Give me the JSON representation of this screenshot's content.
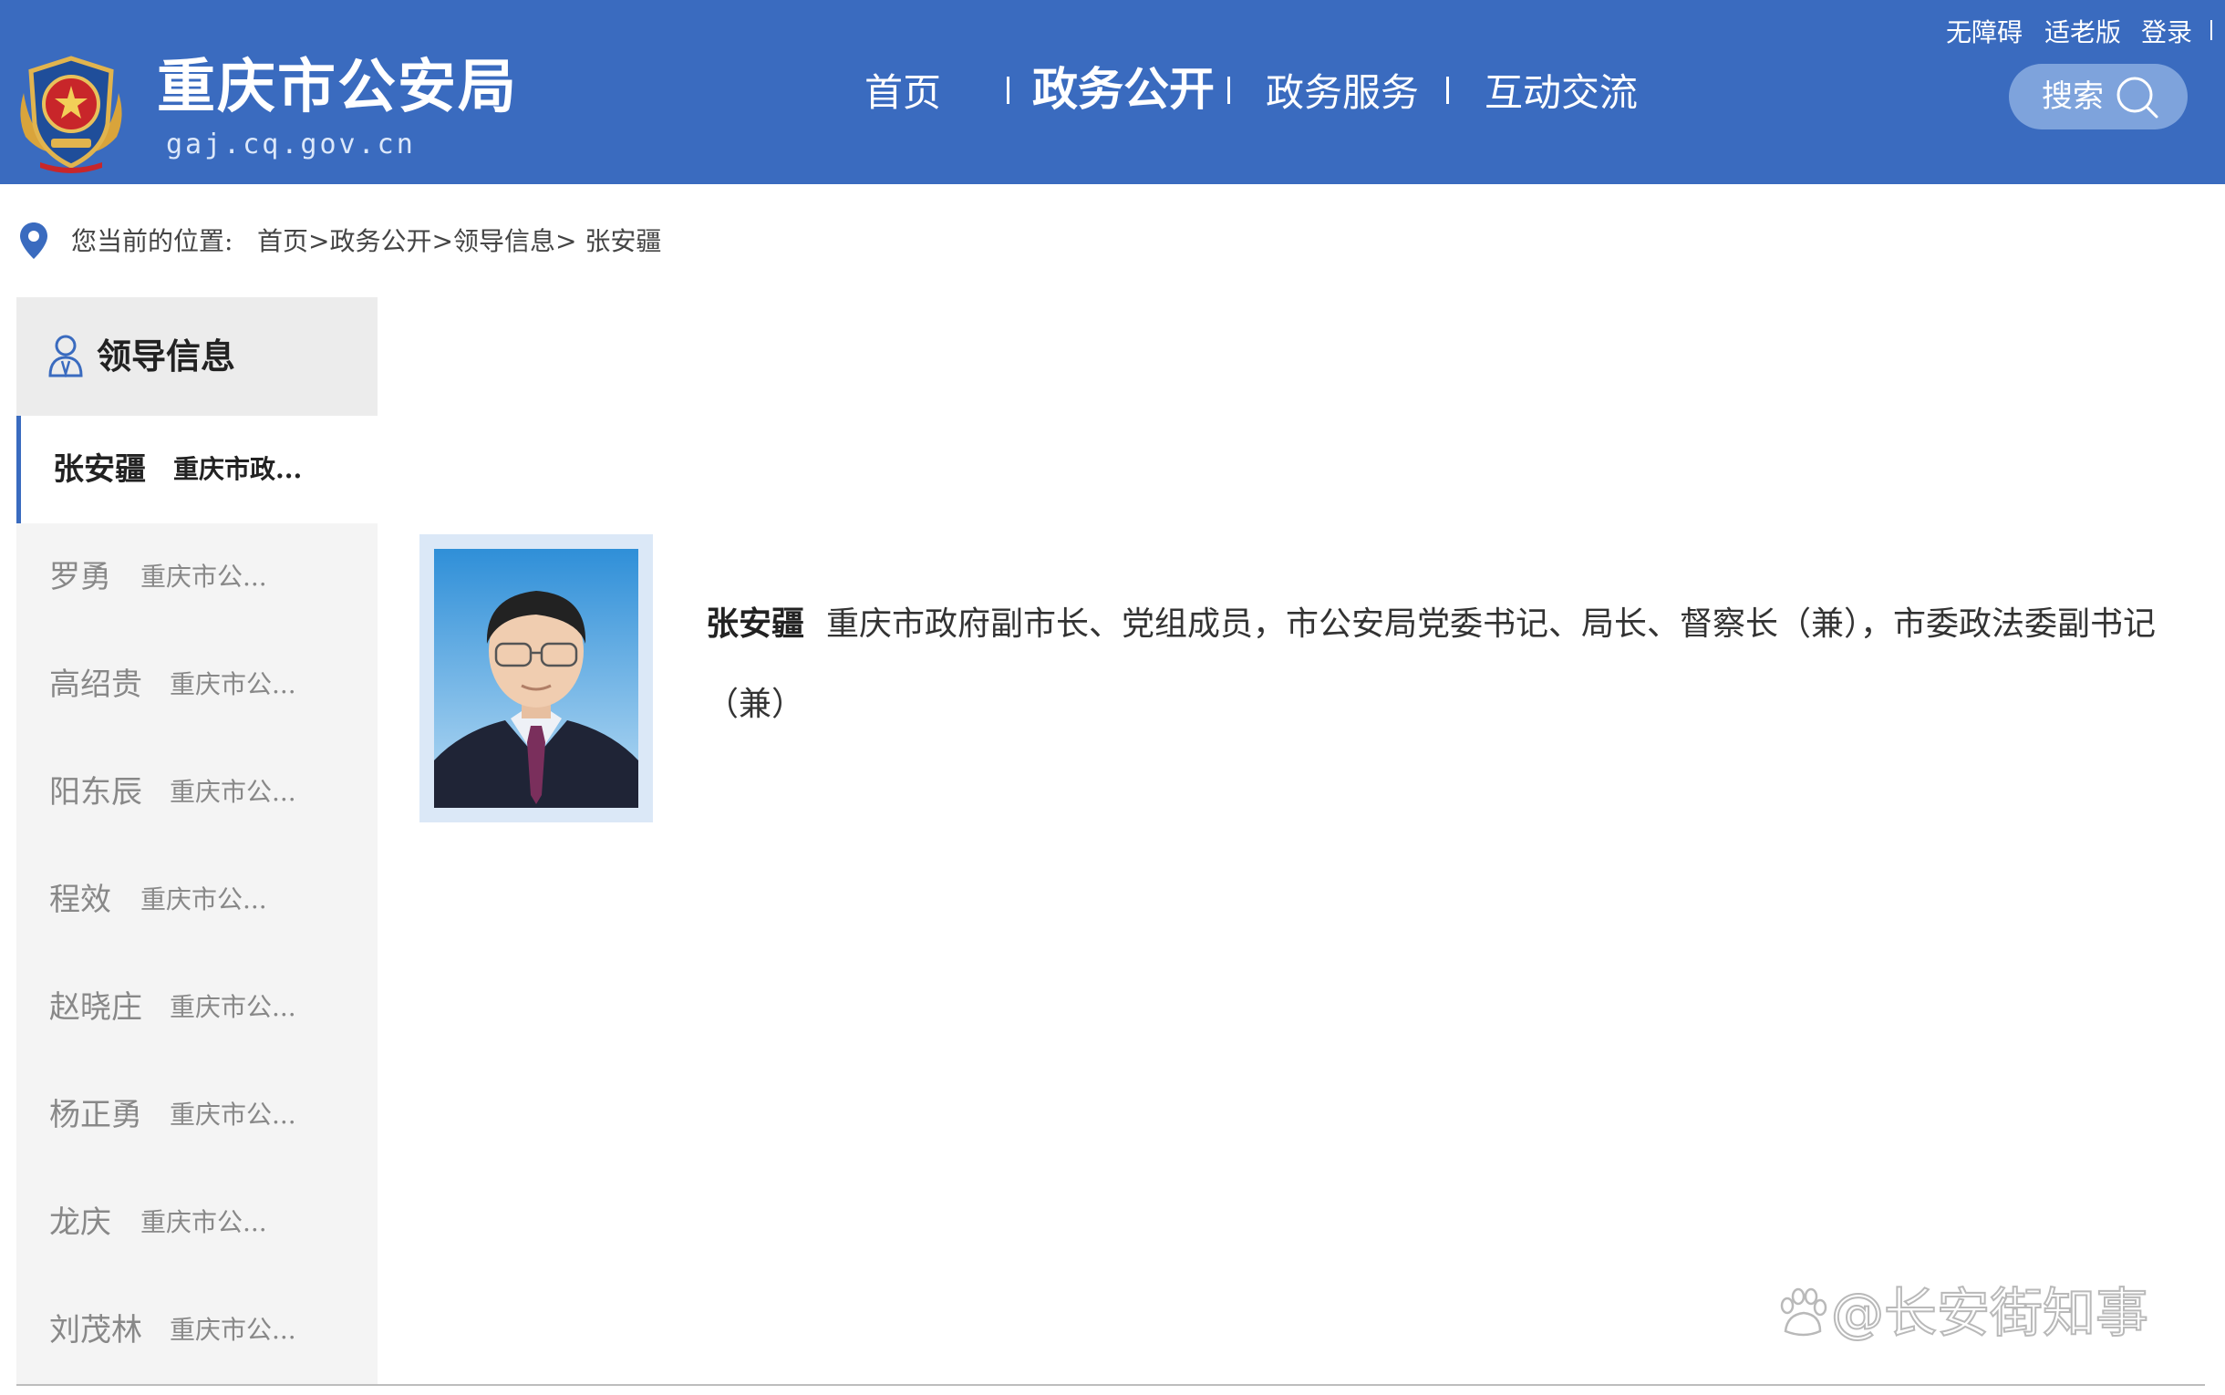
{
  "header": {
    "site_name": "重庆市公安局",
    "site_domain": "gaj.cq.gov.cn",
    "brand_color": "#3a6bbf",
    "emblem_icon": "police-emblem-icon",
    "nav": [
      {
        "label": "首页",
        "active": false
      },
      {
        "label": "政务公开",
        "active": true
      },
      {
        "label": "政务服务",
        "active": false
      },
      {
        "label": "互动交流",
        "active": false
      }
    ],
    "top_links": [
      "无障碍",
      "适老版",
      "登录"
    ],
    "search": {
      "label": "搜索",
      "icon": "search-icon"
    }
  },
  "breadcrumb": {
    "icon": "location-pin-icon",
    "prefix": "您当前的位置:",
    "items": [
      "首页",
      "政务公开",
      "领导信息",
      "张安疆"
    ],
    "separator": ">"
  },
  "sidebar": {
    "title": "领导信息",
    "icon": "user-icon",
    "items": [
      {
        "name": "张安疆",
        "title": "重庆市政...",
        "active": true
      },
      {
        "name": "罗勇",
        "title": "重庆市公...",
        "active": false
      },
      {
        "name": "高绍贵",
        "title": "重庆市公...",
        "active": false
      },
      {
        "name": "阳东辰",
        "title": "重庆市公...",
        "active": false
      },
      {
        "name": "程效",
        "title": "重庆市公...",
        "active": false
      },
      {
        "name": "赵晓庄",
        "title": "重庆市公...",
        "active": false
      },
      {
        "name": "杨正勇",
        "title": "重庆市公...",
        "active": false
      },
      {
        "name": "龙庆",
        "title": "重庆市公...",
        "active": false
      },
      {
        "name": "刘茂林",
        "title": "重庆市公...",
        "active": false
      }
    ]
  },
  "leader": {
    "name": "张安疆",
    "bio": "重庆市政府副市长、党组成员，市公安局党委书记、局长、督察长（兼），市委政法委副书记（兼）"
  },
  "watermark": {
    "icon": "baidu-paw-icon",
    "text": "@长安街知事"
  }
}
